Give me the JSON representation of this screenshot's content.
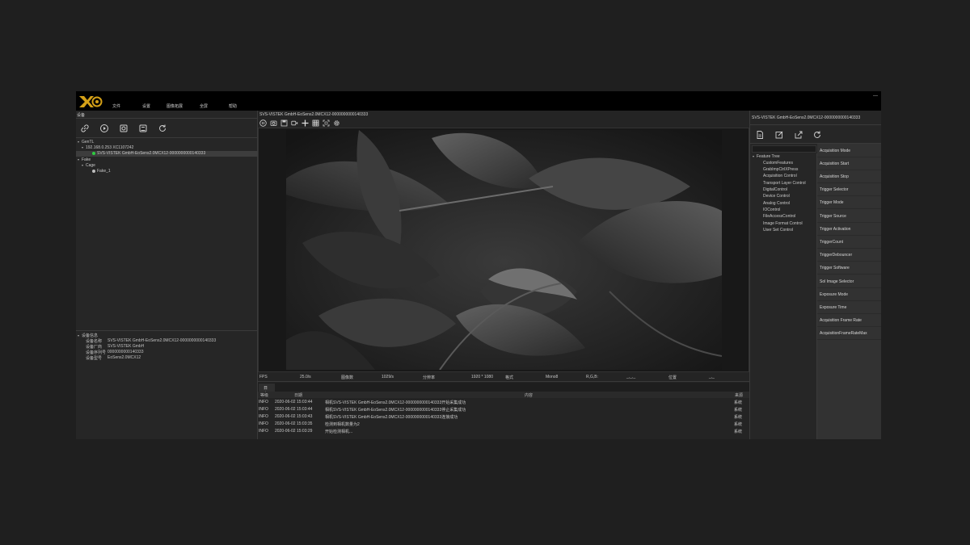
{
  "menu": [
    "文件",
    "设置",
    "图像拓展",
    "全屏",
    "帮助"
  ],
  "window": {
    "minimize_glyph": "—"
  },
  "left_panel": {
    "header": "设备",
    "toolbar_icons": [
      "link-icon",
      "play-circle-icon",
      "camera-settings-icon",
      "camera-list-icon",
      "refresh-icon"
    ],
    "tree": {
      "gentl": "GenTL",
      "interface": "192.168.0.253 XC1107242",
      "device": "SVS-VISTEK GmbH-EoSens2.0MCX12-0000000000140333",
      "fake": "Fake",
      "cage": "Cage",
      "fake_device": "Fake_1"
    },
    "device_info": {
      "header": "设备信息",
      "rows": [
        {
          "label": "设备名称",
          "value": "SVS-VISTEK GmbH-EoSens2.0MCX12-0000000000140333"
        },
        {
          "label": "设备厂商",
          "value": "SVS-VISTEK GmbH"
        },
        {
          "label": "设备序列号",
          "value": "0000000000140333"
        },
        {
          "label": "设备型号",
          "value": "EoSens2.0MCX12"
        }
      ]
    }
  },
  "viewer": {
    "title": "SVS-VISTEK GmbH-EoSens2.0MCX12-0000000000140333",
    "toolbar_icons": [
      "pause-icon",
      "snapshot-icon",
      "save-image-icon",
      "record-icon",
      "crosshair-icon",
      "grid-icon",
      "fit-screen-icon",
      "settings-icon"
    ],
    "status": {
      "fps_label": "FPS",
      "fps_value": "25.0/s",
      "frames_label": "图像数",
      "frames_value": "1029/s",
      "res_label": "分辨率",
      "res_value": "1920 * 1080",
      "format_label": "格式",
      "format_value": "Mono8",
      "rgb_label": "R,G,B:",
      "rgb_value": "_,_,_",
      "pos_label": "位置",
      "pos_value": "_,_"
    }
  },
  "log": {
    "tab": "日志",
    "headers": {
      "level": "等级",
      "date": "日期",
      "content": "内容",
      "source": "来源"
    },
    "rows": [
      {
        "level": "INFO",
        "date": "2020-06-02 15:03:44",
        "content": "相机SVS-VISTEK GmbH-EoSens2.0MCX12-0000000000140333开始采集成功",
        "source": "系统"
      },
      {
        "level": "INFO",
        "date": "2020-06-02 15:03:44",
        "content": "相机SVS-VISTEK GmbH-EoSens2.0MCX12-0000000000140333停止采集成功",
        "source": "系统"
      },
      {
        "level": "INFO",
        "date": "2020-06-02 15:03:43",
        "content": "相机SVS-VISTEK GmbH-EoSens2.0MCX12-0000000000140333连接成功",
        "source": "系统"
      },
      {
        "level": "INFO",
        "date": "2020-06-02 15:03:35",
        "content": "检测到相机数量为2",
        "source": "系统"
      },
      {
        "level": "INFO",
        "date": "2020-06-02 15:03:29",
        "content": "开始检测相机...",
        "source": "系统"
      }
    ]
  },
  "right_panel": {
    "title": "SVS-VISTEK GmbH-EoSens2.0MCX12-0000000000140333",
    "toolbar_icons": [
      "document-icon",
      "edit-icon",
      "export-icon",
      "refresh-icon"
    ],
    "feature_tree": {
      "root": "Feature Tree",
      "items": [
        "CustomFeatures",
        "GrabImpCtrlXPress",
        "Acquisition Control",
        "Transport Layer Control",
        "DigitalControl",
        "Device Control",
        "Analog Control",
        "IOControl",
        "FileAccessControl",
        "Image Format Control",
        "User Set Control"
      ]
    },
    "features": [
      "Acquisition Mode",
      "Acquisition Start",
      "Acquisition Stop",
      "Trigger Selector",
      "Trigger Mode",
      "Trigger Source",
      "Trigger Activation",
      "TriggerCount",
      "TriggerDebouncer",
      "Trigger Software",
      "Sol Image Selector",
      "Exposure Mode",
      "Exposure Time",
      "Acquisition Frame Rate",
      "AcquisitionFrameRateMax"
    ]
  },
  "colors": {
    "green_dot": "#2ecc40",
    "grey_dot": "#bdbdbd",
    "logo_gold": "#d4a017"
  }
}
